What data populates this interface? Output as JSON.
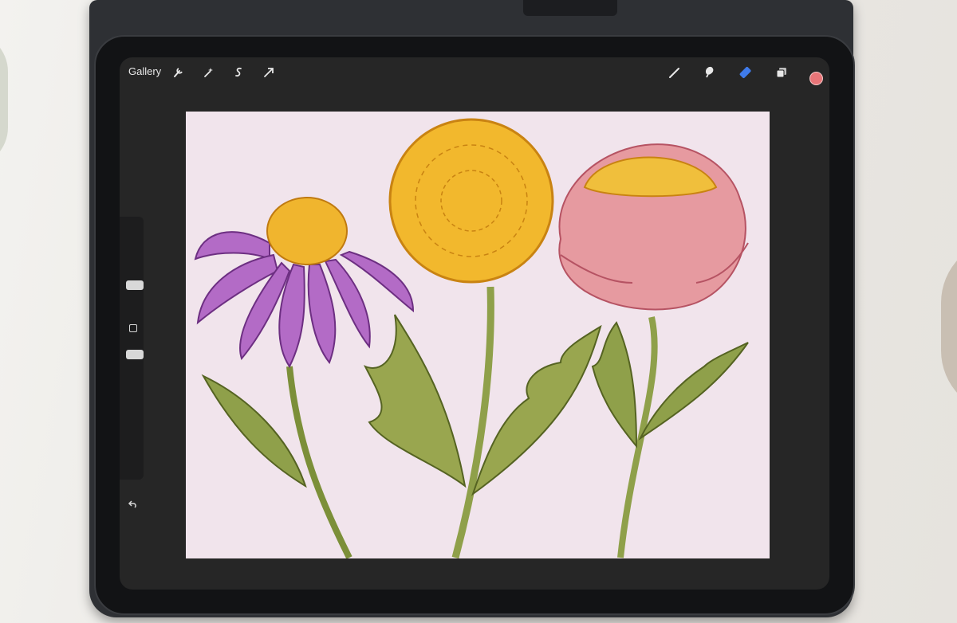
{
  "toolbar": {
    "gallery_label": "Gallery",
    "left_tools": [
      "wrench-icon",
      "magic-wand-icon",
      "selection-icon",
      "transform-icon"
    ],
    "right_tools": [
      "brush-icon",
      "smudge-icon",
      "eraser-icon",
      "layers-icon"
    ],
    "active_tool": "eraser-icon",
    "active_color": "#e87578",
    "eraser_color": "#3f7bea"
  },
  "sidebar": {
    "controls": [
      "brush-size-slider",
      "modify-button",
      "opacity-slider",
      "undo-icon"
    ]
  },
  "canvas": {
    "background": "#f1e4ec",
    "flowers": [
      {
        "name": "purple-coneflower",
        "petal_color": "#b36bc6",
        "center_color": "#f0b52e"
      },
      {
        "name": "yellow-chrysanthemum",
        "petal_color": "#f2b82d"
      },
      {
        "name": "pink-peony",
        "petal_color": "#e69aa0",
        "center_color": "#f0bf3c"
      }
    ],
    "leaf_color": "#8fa04a"
  }
}
